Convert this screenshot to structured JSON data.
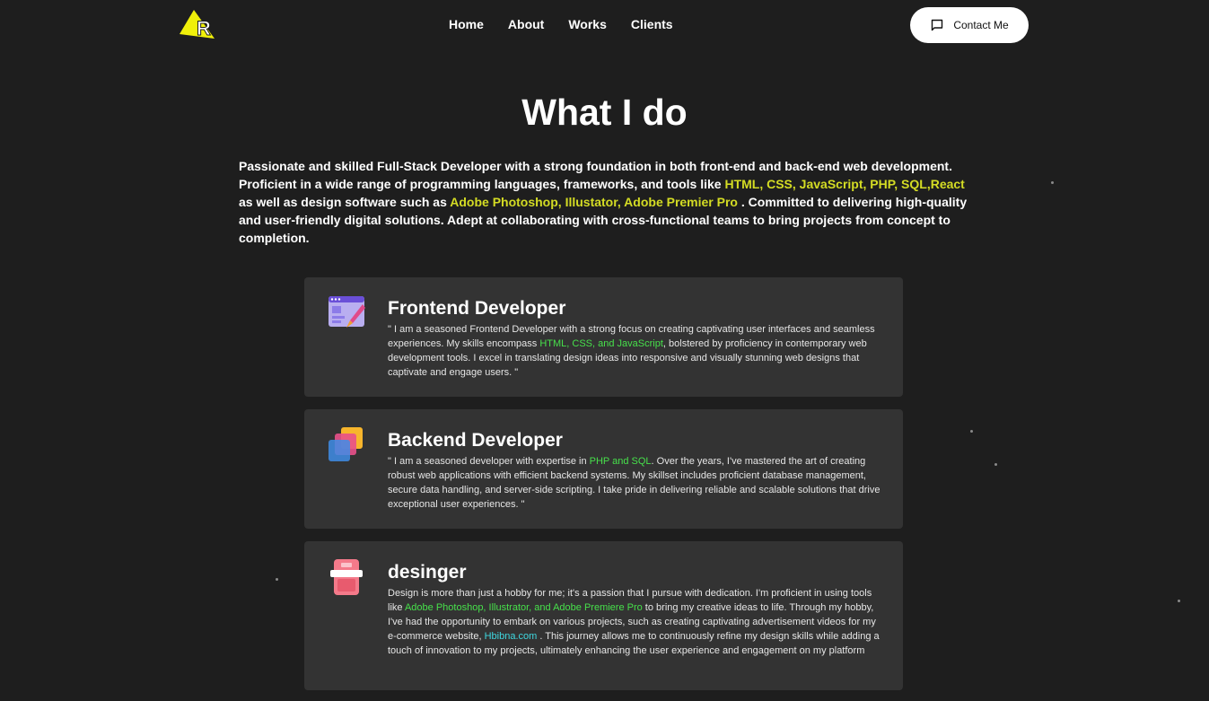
{
  "header": {
    "logo_letter": "R",
    "nav": [
      "Home",
      "About",
      "Works",
      "Clients"
    ],
    "contact_label": "Contact Me"
  },
  "section": {
    "title": "What I do",
    "intro": {
      "t1": "Passionate and skilled Full-Stack Developer with a strong foundation in both front-end and back-end web development. Proficient in a wide range of programming languages, frameworks, and tools like ",
      "h1": "HTML, CSS, JavaScript, PHP, SQL,React",
      "t2": " as well as design software such as ",
      "h2": "Adobe Photoshop, Illustator, Adobe Premier Pro",
      "t3": " . Committed to delivering high-quality and user-friendly digital solutions. Adept at collaborating with cross-functional teams to bring projects from concept to completion."
    }
  },
  "cards": [
    {
      "title": "Frontend Developer",
      "t1": "\" I am a seasoned Frontend Developer with a strong focus on creating captivating user interfaces and seamless experiences. My skills encompass ",
      "h1": "HTML, CSS, and JavaScript",
      "t2": ", bolstered by proficiency in contemporary web development tools. I excel in translating design ideas into responsive and visually stunning web designs that captivate and engage users. \""
    },
    {
      "title": "Backend Developer",
      "t1": "\" I am a seasoned developer with expertise in ",
      "h1": "PHP and SQL",
      "t2": ". Over the years, I've mastered the art of creating robust web applications with efficient backend systems. My skillset includes proficient database management, secure data handling, and server-side scripting. I take pride in delivering reliable and scalable solutions that drive exceptional user experiences. \""
    },
    {
      "title": "desinger",
      "t1": "Design is more than just a hobby for me; it's a passion that I pursue with dedication. I'm proficient in using tools like ",
      "h1": "Adobe Photoshop, Illustrator, and Adobe Premiere Pro",
      "t2": " to bring my creative ideas to life. Through my hobby, I've had the opportunity to embark on various projects, such as creating captivating advertisement videos for my e-commerce website, ",
      "h2": "Hbibna.com",
      "t3": " . This journey allows me to continuously refine my design skills while adding a touch of innovation to my projects, ultimately enhancing the user experience and engagement on my platform"
    }
  ],
  "colors": {
    "background": "#1e1e1e",
    "card": "#333333",
    "accent_yellow": "#d4dc24",
    "accent_green": "#47e04b",
    "accent_cyan": "#3fd8e0"
  }
}
